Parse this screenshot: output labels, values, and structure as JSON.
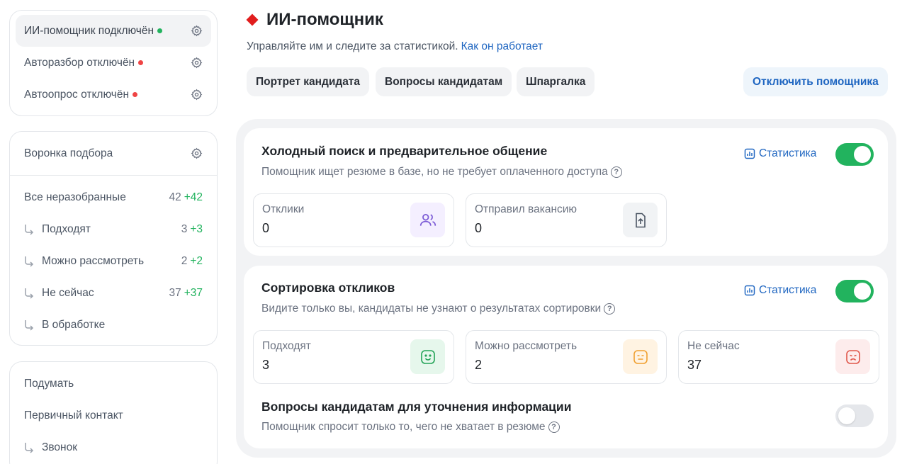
{
  "sidebar": {
    "assistants": [
      {
        "label": "ИИ-помощник подключён",
        "status": "green"
      },
      {
        "label": "Авторазбор отключён",
        "status": "red"
      },
      {
        "label": "Автоопрос отключён",
        "status": "red"
      }
    ],
    "funnel": {
      "title": "Воронка подбора",
      "items": [
        {
          "label": "Все неразобранные",
          "count": "42",
          "delta": "+42"
        },
        {
          "label": "Подходят",
          "count": "3",
          "delta": "+3"
        },
        {
          "label": "Можно рассмотреть",
          "count": "2",
          "delta": "+2"
        },
        {
          "label": "Не сейчас",
          "count": "37",
          "delta": "+37"
        },
        {
          "label": "В обработке",
          "count": "",
          "delta": ""
        }
      ]
    },
    "pipeline": [
      {
        "label": "Подумать"
      },
      {
        "label": "Первичный контакт"
      },
      {
        "label": "Звонок"
      }
    ]
  },
  "header": {
    "title": "ИИ-помощник",
    "subtitle": "Управляйте им и следите за статистикой.",
    "subtitle_link": "Как он работает",
    "tabs": [
      "Портрет кандидата",
      "Вопросы кандидатам",
      "Шпаргалка"
    ],
    "disable_button": "Отключить помощника"
  },
  "sections": {
    "cold": {
      "title": "Холодный поиск и предварительное общение",
      "desc": "Помощник ищет резюме в базе, но не требует оплаченного доступа",
      "stats_link": "Статистика",
      "enabled": true,
      "metrics": [
        {
          "label": "Отклики",
          "value": "0",
          "icon": "users-icon"
        },
        {
          "label": "Отправил вакансию",
          "value": "0",
          "icon": "upload-icon"
        }
      ]
    },
    "sorting": {
      "title": "Сортировка откликов",
      "desc": "Видите только вы, кандидаты не узнают о результатах сортировки",
      "stats_link": "Статистика",
      "enabled": true,
      "metrics": [
        {
          "label": "Подходят",
          "value": "3",
          "icon": "smile-icon"
        },
        {
          "label": "Можно рассмотреть",
          "value": "2",
          "icon": "neutral-face-icon"
        },
        {
          "label": "Не сейчас",
          "value": "37",
          "icon": "sad-face-icon"
        }
      ]
    },
    "questions": {
      "title": "Вопросы кандидатам для уточнения информации",
      "desc": "Помощник спросит только то, чего не хватает в резюме",
      "enabled": false
    }
  },
  "colors": {
    "accent": "#1f66c1",
    "success": "#22b35e",
    "danger": "#ef4444",
    "brand": "#e11d1d"
  }
}
